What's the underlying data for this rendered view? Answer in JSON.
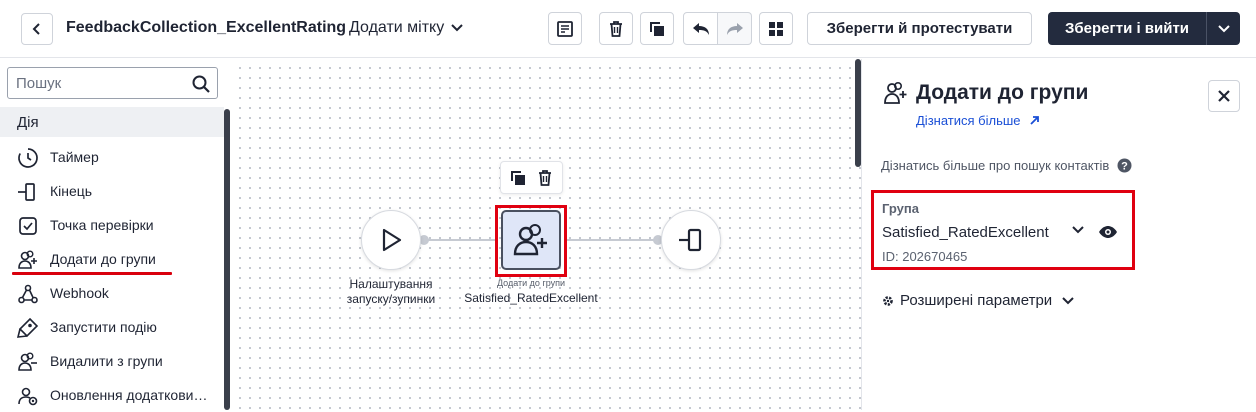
{
  "header": {
    "workflow_name": "FeedbackCollection_ExcellentRating",
    "add_tag": "Додати мітку",
    "save_test": "Зберегти й протестувати",
    "save_exit": "Зберегти і вийти"
  },
  "sidebar": {
    "search_placeholder": "Пошук",
    "section": "Дія",
    "items": [
      {
        "label": "Таймер",
        "icon": "timer-icon"
      },
      {
        "label": "Кінець",
        "icon": "end-icon"
      },
      {
        "label": "Точка перевірки",
        "icon": "checkpoint-icon"
      },
      {
        "label": "Додати до групи",
        "icon": "add-to-group-icon",
        "highlighted": true
      },
      {
        "label": "Webhook",
        "icon": "webhook-icon"
      },
      {
        "label": "Запустити подію",
        "icon": "trigger-event-icon"
      },
      {
        "label": "Видалити з групи",
        "icon": "remove-from-group-icon"
      },
      {
        "label": "Оновлення додаткови…",
        "icon": "update-fields-icon"
      }
    ]
  },
  "canvas": {
    "start_node": {
      "label_line1": "Налаштування",
      "label_line2": "запуску/зупинки"
    },
    "group_node": {
      "mini_label": "Додати до групи",
      "label": "Satisfied_RatedExcellent"
    }
  },
  "panel": {
    "title": "Додати до групи",
    "learn_more": "Дізнатися більше",
    "info": "Дізнатись більше про пошук контактів",
    "group_label": "Група",
    "group_value": "Satisfied_RatedExcellent",
    "group_id": "ID: 202670465",
    "advanced": "Розширені параметри"
  },
  "colors": {
    "accent": "#e00010",
    "link": "#1a4fd6",
    "primary_button": "#232b3e",
    "node_fill": "#dfe6f8"
  }
}
